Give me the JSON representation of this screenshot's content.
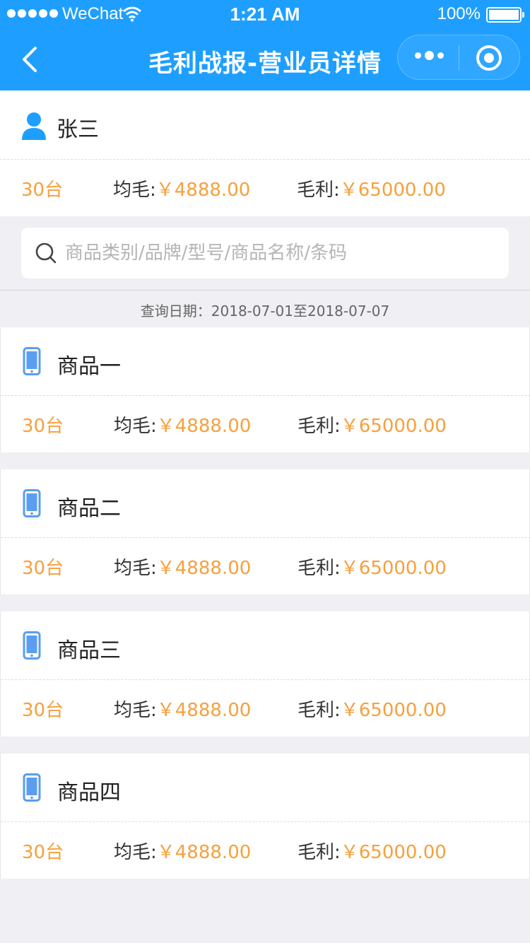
{
  "status_bar": {
    "carrier": "WeChat",
    "time": "1:21 AM",
    "battery": "100%"
  },
  "nav": {
    "title": "毛利战报-营业员详情"
  },
  "salesperson": {
    "name": "张三",
    "qty": "30台",
    "avg_label": "均毛:",
    "avg_value": "￥4888.00",
    "profit_label": "毛利:",
    "profit_value": "￥65000.00"
  },
  "search": {
    "placeholder": "商品类别/品牌/型号/商品名称/条码",
    "value": ""
  },
  "query_date": "查询日期：2018-07-01至2018-07-07",
  "products": [
    {
      "name": "商品一",
      "qty": "30台",
      "avg_label": "均毛:",
      "avg_value": "￥4888.00",
      "profit_label": "毛利:",
      "profit_value": "￥65000.00"
    },
    {
      "name": "商品二",
      "qty": "30台",
      "avg_label": "均毛:",
      "avg_value": "￥4888.00",
      "profit_label": "毛利:",
      "profit_value": "￥65000.00"
    },
    {
      "name": "商品三",
      "qty": "30台",
      "avg_label": "均毛:",
      "avg_value": "￥4888.00",
      "profit_label": "毛利:",
      "profit_value": "￥65000.00"
    },
    {
      "name": "商品四",
      "qty": "30台",
      "avg_label": "均毛:",
      "avg_value": "￥4888.00",
      "profit_label": "毛利:",
      "profit_value": "￥65000.00"
    }
  ],
  "colors": {
    "header": "#1e9fff",
    "accent_orange": "#f7a03c",
    "person_icon": "#1e9fff",
    "phone_icon": "#5b9df0"
  },
  "icons": {
    "back": "chevron-left-icon",
    "more": "more-dots-icon",
    "close": "target-close-icon",
    "person": "person-icon",
    "search": "search-icon",
    "product": "phone-icon"
  }
}
